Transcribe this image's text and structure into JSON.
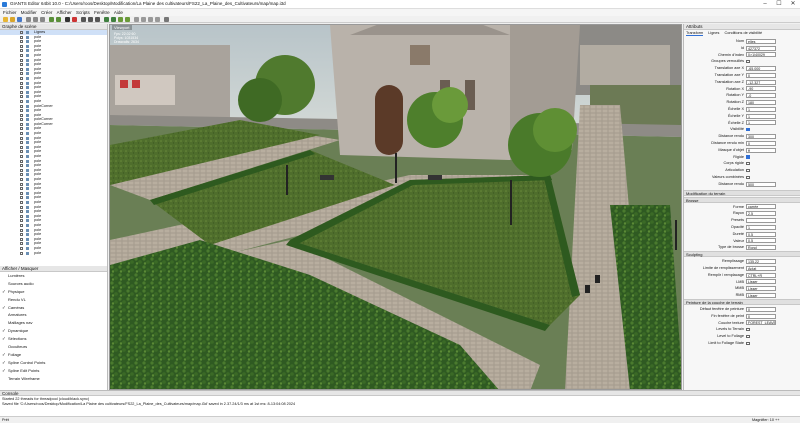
{
  "window": {
    "title": "GIANTS Editor 64bit 10.0 - C:/Users/roos/Desktop/Modification/La Plaine des cultivateurs/FS22_La_Plaine_des_Cultivateurs/map/map.i3d",
    "minimize": "–",
    "maximize": "☐",
    "close": "✕"
  },
  "menu": [
    "Fichier",
    "Modifier",
    "Créer",
    "Afficher",
    "Scripts",
    "Fenêtre",
    "Aide"
  ],
  "scenegraph": {
    "header": "Graphe de scène",
    "items": [
      "Lignes",
      "pole",
      "pole",
      "pole",
      "pole",
      "pole",
      "pole",
      "pole",
      "pole",
      "pole",
      "pole",
      "pole",
      "pole",
      "pole",
      "pole",
      "pole",
      "poleCorner",
      "pole",
      "pole",
      "poleCorner",
      "poleCorner",
      "pole",
      "pole",
      "pole",
      "pole",
      "pole",
      "pole",
      "pole",
      "pole",
      "pole",
      "pole",
      "pole",
      "pole",
      "pole",
      "pole",
      "pole",
      "pole",
      "pole",
      "pole",
      "pole",
      "pole",
      "pole",
      "pole",
      "pole",
      "pole",
      "pole",
      "pole",
      "pole",
      "pole"
    ]
  },
  "layers": {
    "header": "Afficher / Masquer",
    "items": [
      {
        "label": "Lumières",
        "checked": false
      },
      {
        "label": "Sources audio",
        "checked": false
      },
      {
        "label": "Physique",
        "checked": true
      },
      {
        "label": "Rendu VL",
        "checked": false
      },
      {
        "label": "Caméras",
        "checked": true
      },
      {
        "label": "Armatures",
        "checked": false
      },
      {
        "label": "Maillages nav",
        "checked": false
      },
      {
        "label": "Dynamique",
        "checked": true
      },
      {
        "label": "Sélections",
        "checked": true
      },
      {
        "label": "Occulteurs",
        "checked": false
      },
      {
        "label": "Foliage",
        "checked": true
      },
      {
        "label": "Spline Control Points",
        "checked": true
      },
      {
        "label": "Spline Edit Points",
        "checked": true
      },
      {
        "label": "Terrain Wireframe",
        "checked": false
      }
    ]
  },
  "viewport": {
    "header": "Viewport",
    "stats": [
      "Fps: 22.02 60",
      "Polys: 1031534",
      "Drawcalls: 2634"
    ]
  },
  "attributes": {
    "header": "Attributs",
    "tabs": [
      "Transform",
      "Lignes",
      "Conditions de visibilité"
    ],
    "props": [
      {
        "k": "Nom",
        "v": "elles"
      },
      {
        "k": "Id",
        "v": "427372"
      },
      {
        "k": "Chemin d'index",
        "v": "0>1|4|0|29"
      },
      {
        "k": "Groupes verrouillés",
        "v": ""
      },
      {
        "k": "Translation axe X",
        "v": "-65.000"
      },
      {
        "k": "Translation axe Y",
        "v": "0"
      },
      {
        "k": "Translation axe Z",
        "v": "-12.327"
      },
      {
        "k": "Rotation X",
        "v": "-90"
      },
      {
        "k": "Rotation Y",
        "v": "-0"
      },
      {
        "k": "Rotation Z",
        "v": "180"
      },
      {
        "k": "Échelle X",
        "v": "1"
      },
      {
        "k": "Échelle Y",
        "v": "1"
      },
      {
        "k": "Échelle Z",
        "v": "1"
      },
      {
        "k": "Visibilité",
        "v": ""
      },
      {
        "k": "Distance rendu",
        "v": "300"
      },
      {
        "k": "Distance rendu min",
        "v": "0"
      },
      {
        "k": "Masque d'objet",
        "v": "ff"
      },
      {
        "k": "Rigide",
        "v": ""
      },
      {
        "k": "Corps rigide",
        "v": ""
      },
      {
        "k": "Articulation",
        "v": ""
      },
      {
        "k": "Valeurs combinées",
        "v": ""
      },
      {
        "k": "Distance rendu",
        "v": "500"
      }
    ],
    "section2": "Modification du terrain",
    "brush_header": "Brosse",
    "brush": [
      {
        "k": "Forme",
        "v": "carrée"
      },
      {
        "k": "Rayon",
        "v": "2.5"
      },
      {
        "k": "Presets",
        "v": ""
      },
      {
        "k": "Opacité",
        "v": "1"
      },
      {
        "k": "Dureté",
        "v": "0.5"
      },
      {
        "k": "Valeur",
        "v": "0.5"
      },
      {
        "k": "Type de brosse",
        "v": "Rond"
      }
    ],
    "sculpt_header": "Sculpting",
    "sculpt": [
      {
        "k": "Remplissage",
        "v": "135.22"
      },
      {
        "k": "Limite de remplissement",
        "v": "Aplat"
      },
      {
        "k": "Remplir / remplacage",
        "v": "CTRL+R"
      },
      {
        "k": "LMB",
        "v": "Lisser"
      },
      {
        "k": "MMB",
        "v": "Lisser"
      },
      {
        "k": "RMB",
        "v": "Lisser"
      }
    ],
    "paint_header": "Peinture de la couche de terrain",
    "paint": [
      {
        "k": "Défaut fenêtre de peinture",
        "v": "0"
      },
      {
        "k": "Fin fenêtre de peint",
        "v": "0"
      },
      {
        "k": "Couche texture",
        "v": "FOREST_LEAVES"
      },
      {
        "k": "Levels to Terrain",
        "v": ""
      },
      {
        "k": "Level to Foliage",
        "v": ""
      },
      {
        "k": "Limit to Foliage State",
        "v": ""
      }
    ]
  },
  "console": {
    "header": "Console",
    "lines": [
      "Started 22 threads for threadpool (cloud/black.sync)",
      "Saved file 'C:/Users/roos/Desktop/Modification/La Plaine des cultivateurs/FS22_La_Plaine_des_Cultivateurs/map/map.i3d' saved in 2.37.24/1/3 ms at 1st ms: 8-13:04:08 2024"
    ]
  },
  "status": {
    "left": "Prêt",
    "right": "Magnifier: 10 ++"
  },
  "colors": {
    "accent": "#2f6fd6",
    "grass": "#5f7a3c"
  }
}
